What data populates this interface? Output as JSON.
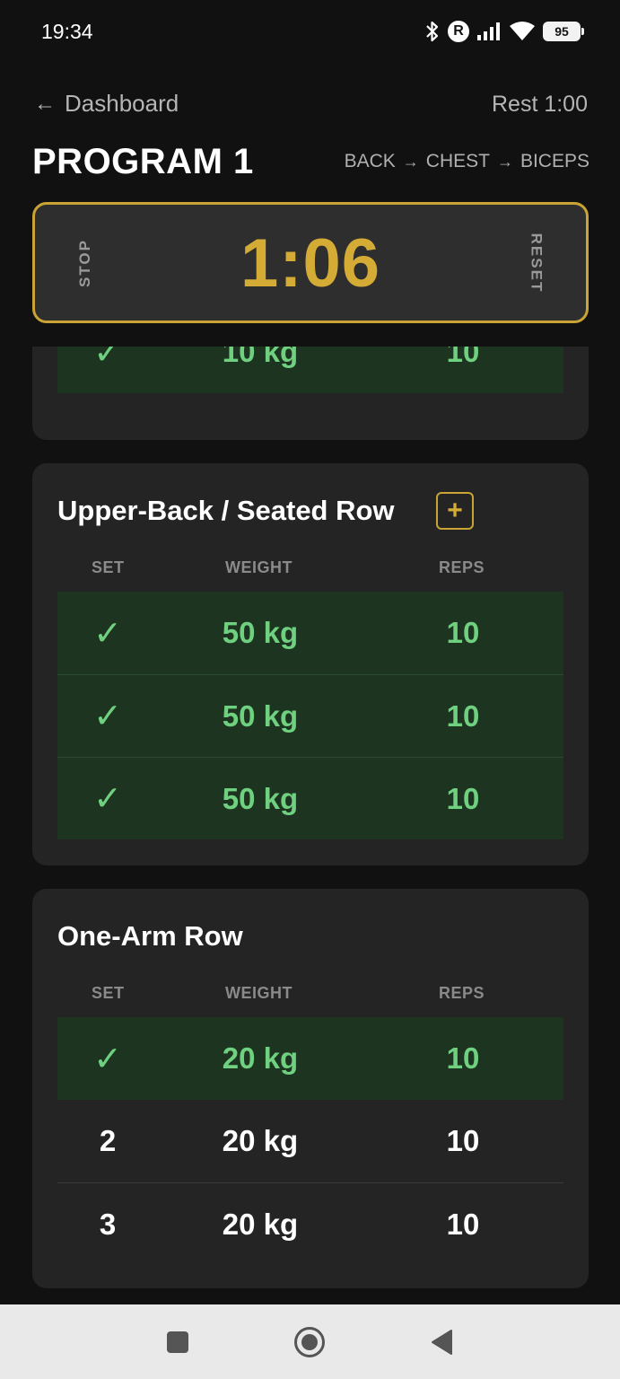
{
  "status_bar": {
    "time": "19:34",
    "r_badge": "R",
    "battery": "95"
  },
  "header": {
    "back_label": "Dashboard",
    "rest_label": "Rest 1:00",
    "program_title": "PROGRAM 1",
    "route": [
      "BACK",
      "CHEST",
      "BICEPS"
    ]
  },
  "timer": {
    "stop_label": "STOP",
    "value": "1:06",
    "reset_label": "RESET"
  },
  "table_headers": {
    "set": "SET",
    "weight": "WEIGHT",
    "reps": "REPS"
  },
  "exercises": [
    {
      "title": "",
      "sets": [
        {
          "set": "✓",
          "weight": "10 kg",
          "reps": "10",
          "done": true
        }
      ]
    },
    {
      "title": "Upper-Back / Seated Row",
      "add_label": "+",
      "sets": [
        {
          "set": "✓",
          "weight": "50 kg",
          "reps": "10",
          "done": true
        },
        {
          "set": "✓",
          "weight": "50 kg",
          "reps": "10",
          "done": true
        },
        {
          "set": "✓",
          "weight": "50 kg",
          "reps": "10",
          "done": true
        }
      ]
    },
    {
      "title": "One-Arm Row",
      "sets": [
        {
          "set": "✓",
          "weight": "20 kg",
          "reps": "10",
          "done": true
        },
        {
          "set": "2",
          "weight": "20 kg",
          "reps": "10",
          "done": false
        },
        {
          "set": "3",
          "weight": "20 kg",
          "reps": "10",
          "done": false
        }
      ]
    }
  ],
  "nav_bar": {
    "icons": [
      "recents-square-icon",
      "home-circle-icon",
      "back-triangle-icon"
    ]
  },
  "colors": {
    "accent": "#d4ab35",
    "done_row": "#1d3520",
    "done_text": "#6fd07f",
    "card": "#242424",
    "background": "#111111"
  }
}
